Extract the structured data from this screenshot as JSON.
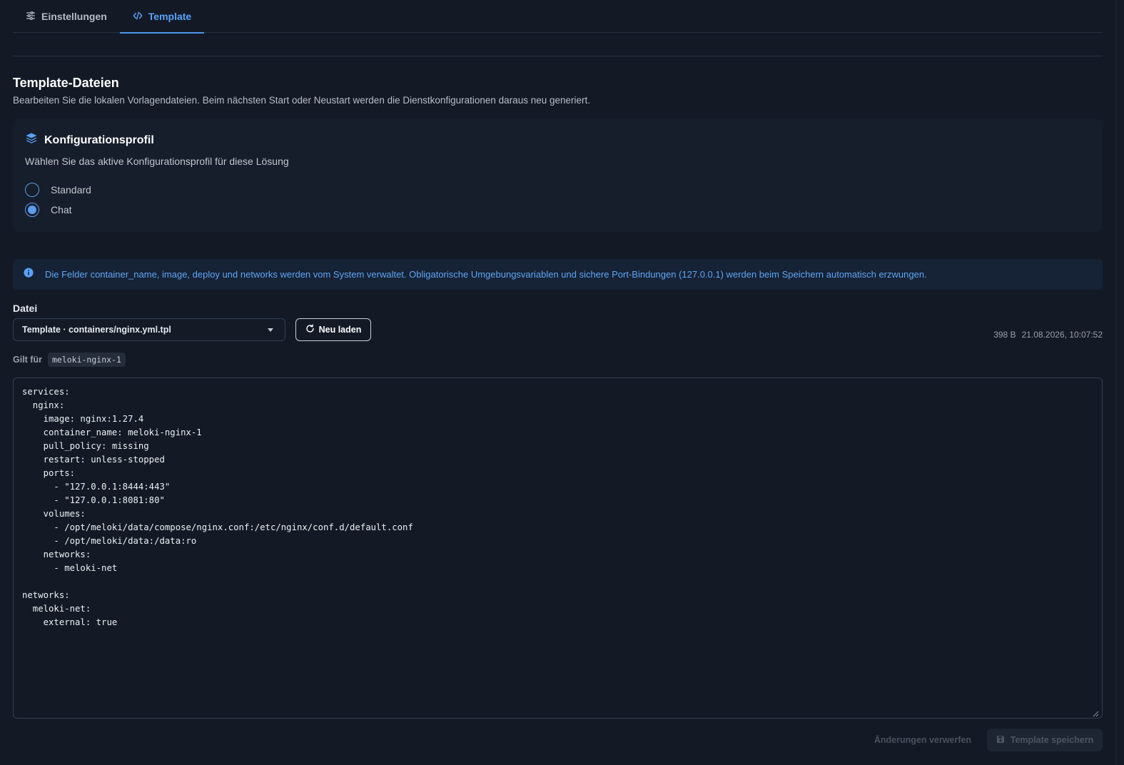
{
  "tabs": [
    {
      "label": "Einstellungen",
      "icon": "sliders-icon",
      "active": false
    },
    {
      "label": "Template",
      "icon": "code-icon",
      "active": true
    }
  ],
  "section": {
    "title": "Template-Dateien",
    "description": "Bearbeiten Sie die lokalen Vorlagendateien. Beim nächsten Start oder Neustart werden die Dienstkonfigurationen daraus neu generiert."
  },
  "profile": {
    "title": "Konfigurationsprofil",
    "icon": "layers-icon",
    "description": "Wählen Sie das aktive Konfigurationsprofil für diese Lösung",
    "options": [
      {
        "label": "Standard",
        "checked": false
      },
      {
        "label": "Chat",
        "checked": true
      }
    ]
  },
  "info": {
    "icon": "info-icon",
    "text": "Die Felder container_name, image, deploy und networks werden vom System verwaltet. Obligatorische Umgebungsvariablen und sichere Port-Bindungen (127.0.0.1) werden beim Speichern automatisch erzwungen."
  },
  "file": {
    "label": "Datei",
    "selected": "Template · containers/nginx.yml.tpl",
    "reload_label": "Neu laden",
    "size": "398 B",
    "modified": "21.08.2026, 10:07:52",
    "applies_label": "Gilt für",
    "applies_value": "meloki-nginx-1"
  },
  "editor": {
    "content": "services:\n  nginx:\n    image: nginx:1.27.4\n    container_name: meloki-nginx-1\n    pull_policy: missing\n    restart: unless-stopped\n    ports:\n      - \"127.0.0.1:8444:443\"\n      - \"127.0.0.1:8081:80\"\n    volumes:\n      - /opt/meloki/data/compose/nginx.conf:/etc/nginx/conf.d/default.conf\n      - /opt/meloki/data:/data:ro\n    networks:\n      - meloki-net\n\nnetworks:\n  meloki-net:\n    external: true"
  },
  "footer": {
    "discard_label": "Änderungen verwerfen",
    "save_label": "Template speichern"
  },
  "colors": {
    "background": "#131a26",
    "accent": "#5aa2f7",
    "card": "#161e2b",
    "info_bg": "#162235"
  }
}
